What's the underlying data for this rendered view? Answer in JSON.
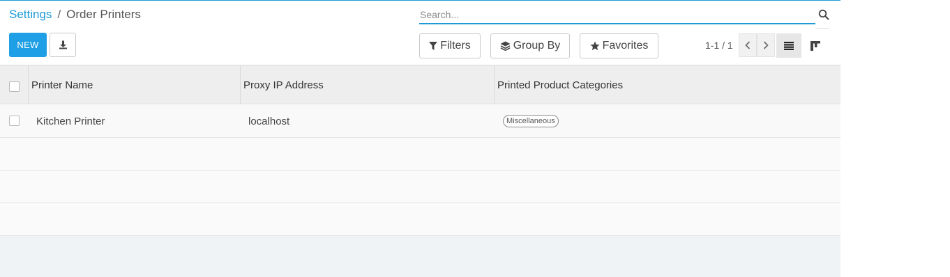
{
  "breadcrumb": {
    "parent": "Settings",
    "separator": "/",
    "current": "Order Printers"
  },
  "toolbar": {
    "new_label": "NEW",
    "download_icon": "download-icon"
  },
  "search": {
    "placeholder": "Search...",
    "value": "",
    "icon": "search-icon"
  },
  "filters": {
    "filters_label": "Filters",
    "groupby_label": "Group By",
    "favorites_label": "Favorites"
  },
  "pager": {
    "value": "1-1 / 1"
  },
  "views": {
    "list_icon": "list-view-icon",
    "kanban_icon": "kanban-view-icon",
    "active": "list"
  },
  "table": {
    "columns": [
      "Printer Name",
      "Proxy IP Address",
      "Printed Product Categories"
    ],
    "rows": [
      {
        "printer_name": "Kitchen Printer",
        "proxy_ip": "localhost",
        "categories": [
          "Miscellaneous"
        ]
      }
    ]
  },
  "colors": {
    "primary": "#1f9fe5",
    "link": "#1e9bd7",
    "header_bg": "#eeeeee"
  }
}
